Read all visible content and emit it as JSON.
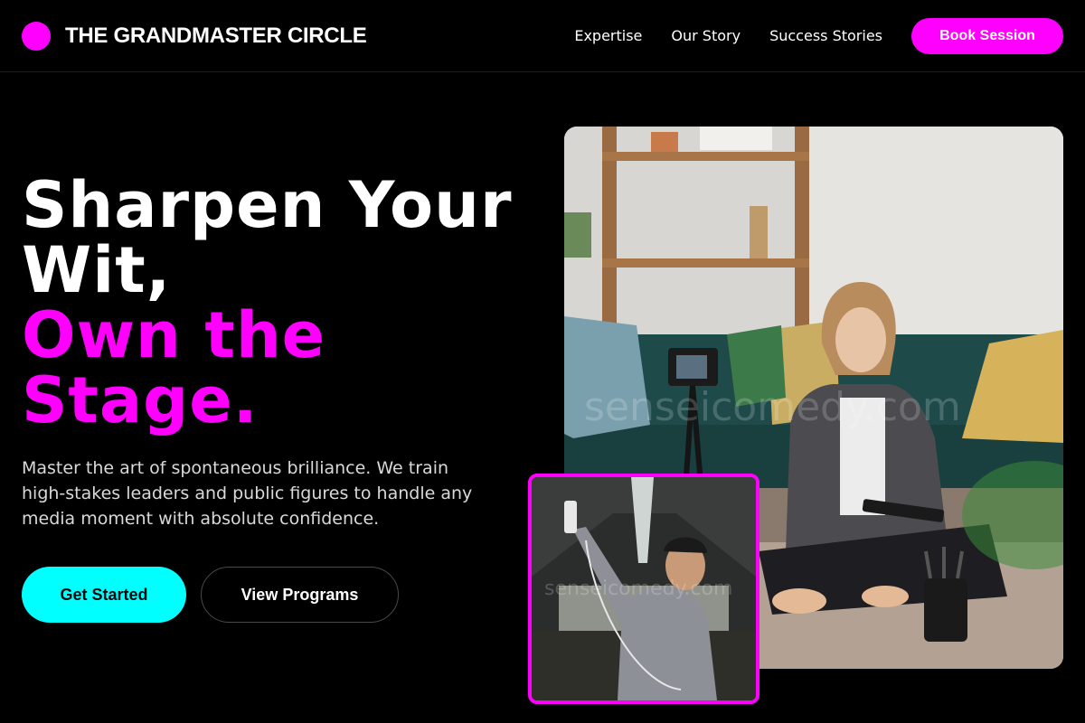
{
  "nav": {
    "brand": "THE GRANDMASTER CIRCLE",
    "links": [
      "Expertise",
      "Our Story",
      "Success Stories"
    ],
    "cta": "Book Session"
  },
  "hero": {
    "headline_line1": "Sharpen Your",
    "headline_line2": "Wit,",
    "headline_accent_line1": "Own the",
    "headline_accent_line2": "Stage.",
    "subtext": "Master the art of spontaneous brilliance. We train high-stakes leaders and public figures to handle any media moment with absolute confidence.",
    "primary_cta": "Get Started",
    "secondary_cta": "View Programs"
  },
  "images": {
    "main": "woman-recording-video-on-floor-photo",
    "inset": "man-taking-selfie-under-bridge-photo",
    "watermark": "senseicomedy.com"
  },
  "colors": {
    "background": "#000000",
    "accent_magenta": "#ff00ff",
    "accent_cyan": "#00ffff"
  }
}
